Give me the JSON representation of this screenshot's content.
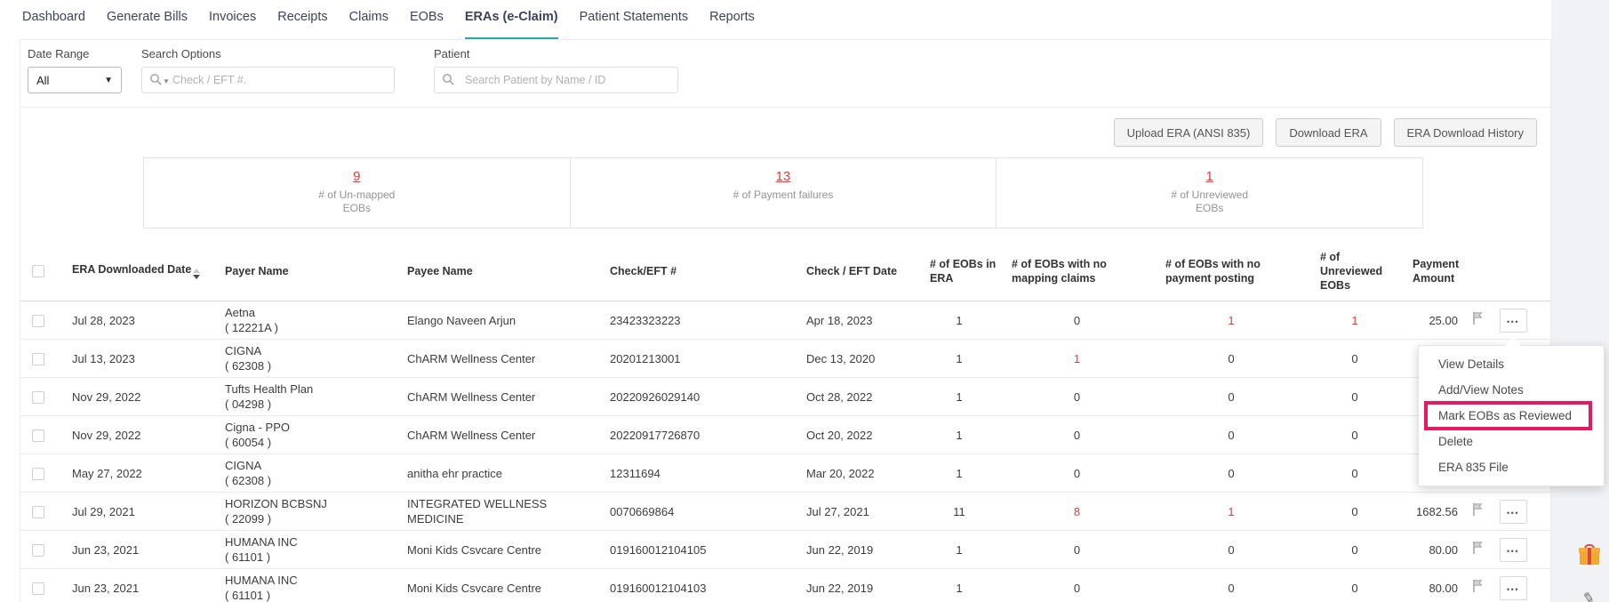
{
  "nav": {
    "tabs": [
      {
        "label": "Dashboard"
      },
      {
        "label": "Generate Bills"
      },
      {
        "label": "Invoices"
      },
      {
        "label": "Receipts"
      },
      {
        "label": "Claims"
      },
      {
        "label": "EOBs"
      },
      {
        "label": "ERAs (e-Claim)"
      },
      {
        "label": "Patient Statements"
      },
      {
        "label": "Reports"
      }
    ],
    "active_tab": "ERAs (e-Claim)"
  },
  "filters": {
    "date_range": {
      "label": "Date Range",
      "value": "All"
    },
    "search_options": {
      "label": "Search Options",
      "placeholder": "Check / EFT #."
    },
    "patient": {
      "label": "Patient",
      "placeholder": "Search Patient by Name / ID"
    }
  },
  "actions": {
    "upload_label": "Upload ERA (ANSI 835)",
    "download_label": "Download ERA",
    "history_label": "ERA Download History"
  },
  "stats": [
    {
      "value": "9",
      "label": "# of Un-mapped EOBs"
    },
    {
      "value": "13",
      "label": "# of Payment failures"
    },
    {
      "value": "1",
      "label": "# of Unreviewed EOBs"
    }
  ],
  "table": {
    "columns": [
      {
        "key": "date",
        "label": "ERA Downloaded Date",
        "sortable": true
      },
      {
        "key": "payer",
        "label": "Payer Name"
      },
      {
        "key": "payee",
        "label": "Payee Name"
      },
      {
        "key": "check_no",
        "label": "Check/EFT #"
      },
      {
        "key": "check_date",
        "label": "Check / EFT Date"
      },
      {
        "key": "eobs_in_era",
        "label": "# of EOBs in ERA"
      },
      {
        "key": "no_mapping",
        "label": "# of EOBs with no mapping claims"
      },
      {
        "key": "no_posting",
        "label": "# of EOBs with no payment posting"
      },
      {
        "key": "unreviewed",
        "label": "# of Unreviewed EOBs"
      },
      {
        "key": "amount",
        "label": "Payment Amount"
      }
    ],
    "rows": [
      {
        "date": "Jul 28, 2023",
        "payer": "Aetna",
        "payer_code": "( 12221A )",
        "payee": "Elango Naveen Arjun",
        "check_no": "23423323223",
        "check_date": "Apr 18, 2023",
        "eobs_in_era": "1",
        "no_mapping": "0",
        "no_posting": "1",
        "unreviewed": "1",
        "amount": "25.00",
        "red": [
          "no_posting",
          "unreviewed"
        ],
        "actions_visible": true
      },
      {
        "date": "Jul 13, 2023",
        "payer": "CIGNA",
        "payer_code": "( 62308 )",
        "payee": "ChARM Wellness Center",
        "check_no": "20201213001",
        "check_date": "Dec 13, 2020",
        "eobs_in_era": "1",
        "no_mapping": "1",
        "no_posting": "0",
        "unreviewed": "0",
        "amount": "",
        "red": [
          "no_mapping"
        ],
        "actions_visible": false
      },
      {
        "date": "Nov 29, 2022",
        "payer": "Tufts Health Plan",
        "payer_code": "( 04298 )",
        "payee": "ChARM Wellness Center",
        "check_no": "20220926029140",
        "check_date": "Oct 28, 2022",
        "eobs_in_era": "1",
        "no_mapping": "0",
        "no_posting": "0",
        "unreviewed": "0",
        "amount": "",
        "red": [],
        "actions_visible": false
      },
      {
        "date": "Nov 29, 2022",
        "payer": "Cigna - PPO",
        "payer_code": "( 60054 )",
        "payee": "ChARM Wellness Center",
        "check_no": "20220917726870",
        "check_date": "Oct 20, 2022",
        "eobs_in_era": "1",
        "no_mapping": "0",
        "no_posting": "0",
        "unreviewed": "0",
        "amount": "",
        "red": [],
        "actions_visible": false
      },
      {
        "date": "May 27, 2022",
        "payer": "CIGNA",
        "payer_code": "( 62308 )",
        "payee": "anitha ehr practice",
        "check_no": "12311694",
        "check_date": "Mar 20, 2022",
        "eobs_in_era": "1",
        "no_mapping": "0",
        "no_posting": "0",
        "unreviewed": "0",
        "amount": "",
        "red": [],
        "actions_visible": false
      },
      {
        "date": "Jul 29, 2021",
        "payer": "HORIZON BCBSNJ",
        "payer_code": "( 22099 )",
        "payee": "INTEGRATED WELLNESS MEDICINE",
        "check_no": "0070669864",
        "check_date": "Jul 27, 2021",
        "eobs_in_era": "11",
        "no_mapping": "8",
        "no_posting": "1",
        "unreviewed": "0",
        "amount": "1682.56",
        "red": [
          "no_mapping",
          "no_posting"
        ],
        "actions_visible": true
      },
      {
        "date": "Jun 23, 2021",
        "payer": "HUMANA INC",
        "payer_code": "( 61101 )",
        "payee": "Moni Kids Csvcare Centre",
        "check_no": "019160012104105",
        "check_date": "Jun 22, 2019",
        "eobs_in_era": "1",
        "no_mapping": "0",
        "no_posting": "0",
        "unreviewed": "0",
        "amount": "80.00",
        "red": [],
        "actions_visible": true
      },
      {
        "date": "Jun 23, 2021",
        "payer": "HUMANA INC",
        "payer_code": "( 61101 )",
        "payee": "Moni Kids Csvcare Centre",
        "check_no": "019160012104103",
        "check_date": "Jun 22, 2019",
        "eobs_in_era": "1",
        "no_mapping": "0",
        "no_posting": "0",
        "unreviewed": "0",
        "amount": "80.00",
        "red": [],
        "actions_visible": true
      }
    ]
  },
  "context_menu": {
    "items": [
      "View Details",
      "Add/View Notes",
      "Mark EOBs as Reviewed",
      "Delete",
      "ERA 835 File"
    ],
    "highlighted_item": "Mark EOBs as Reviewed"
  },
  "colors": {
    "accent_teal": "#2aa7a0",
    "alert_red": "#e53935",
    "highlight_pink": "#e5195f"
  }
}
